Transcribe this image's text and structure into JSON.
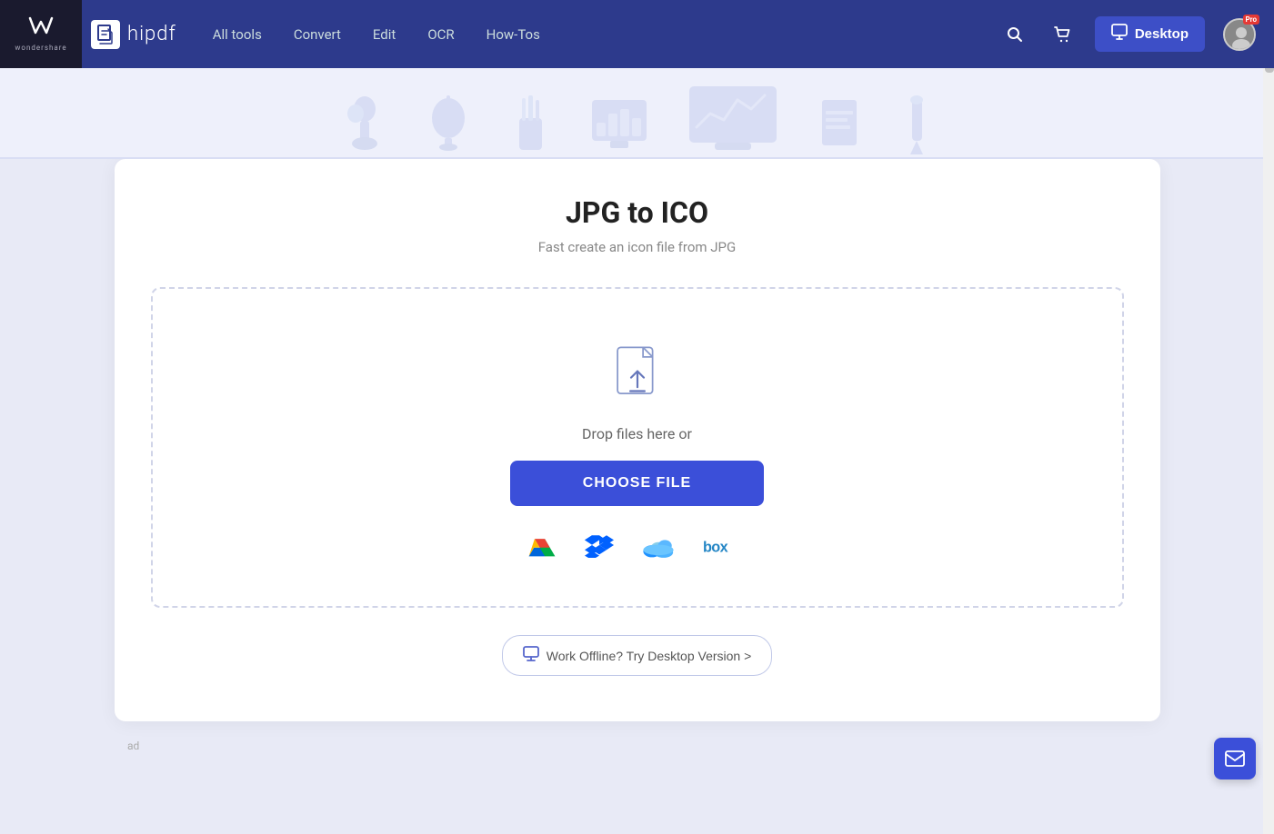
{
  "brand": {
    "wondershare_label": "wondershare",
    "hipdf_label": "hipdf",
    "hipdf_icon": "h"
  },
  "navbar": {
    "all_tools_label": "All tools",
    "convert_label": "Convert",
    "edit_label": "Edit",
    "ocr_label": "OCR",
    "how_tos_label": "How-Tos",
    "desktop_btn_label": "Desktop",
    "pro_badge": "Pro"
  },
  "page": {
    "title": "JPG to ICO",
    "subtitle": "Fast create an icon file from JPG",
    "drop_text": "Drop files here or",
    "choose_file_btn": "CHOOSE FILE",
    "offline_text": "Work Offline? Try Desktop Version >",
    "ad_text": "ad"
  },
  "cloud_services": [
    {
      "name": "google-drive",
      "label": "Google Drive"
    },
    {
      "name": "dropbox",
      "label": "Dropbox"
    },
    {
      "name": "onedrive",
      "label": "OneDrive"
    },
    {
      "name": "box",
      "label": "Box"
    }
  ]
}
